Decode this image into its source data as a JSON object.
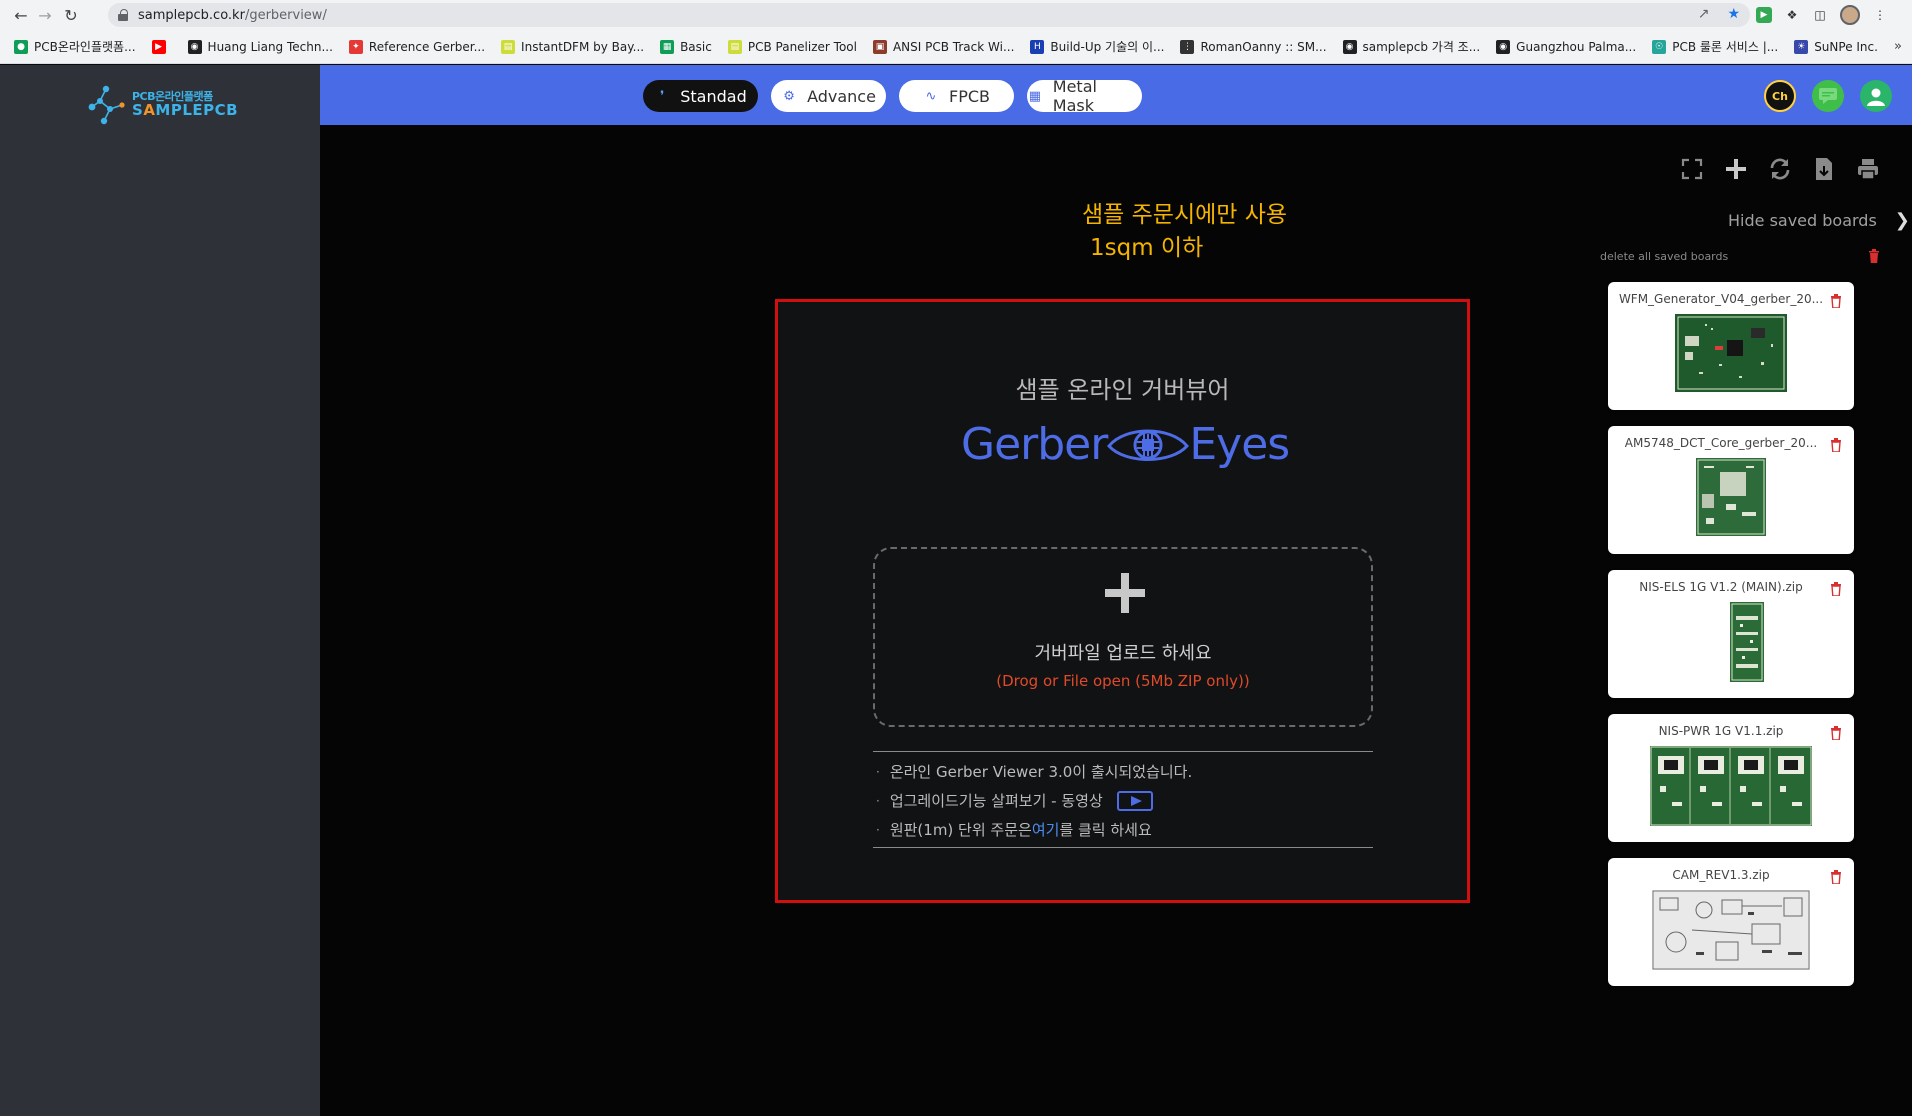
{
  "browser": {
    "url_domain": "samplepcb.co.kr",
    "url_path": "/gerberview/",
    "bookmarks": [
      {
        "label": "PCB온라인플랫폼...",
        "color": "#0f9d58",
        "icon": "green-leaf-icon"
      },
      {
        "label": "",
        "color": "#ff0000",
        "icon": "youtube-icon"
      },
      {
        "label": "Huang Liang Techn...",
        "color": "#202124",
        "icon": "globe-icon"
      },
      {
        "label": "Reference Gerber...",
        "color": "#e53935",
        "icon": "red-square-icon"
      },
      {
        "label": "InstantDFM by Bay...",
        "color": "#cddc39",
        "icon": "dfm-icon"
      },
      {
        "label": "Basic",
        "color": "#0f9d58",
        "icon": "sheets-icon"
      },
      {
        "label": "PCB Panelizer Tool",
        "color": "#cddc39",
        "icon": "panel-icon"
      },
      {
        "label": "ANSI PCB Track Wi...",
        "color": "#8d3b2a",
        "icon": "ansi-icon"
      },
      {
        "label": "Build-Up 기술의 이...",
        "color": "#1a3fb3",
        "icon": "h-icon"
      },
      {
        "label": "RomanOanny :: SM...",
        "color": "#333333",
        "icon": "dots-icon"
      },
      {
        "label": "samplepcb 가격 조...",
        "color": "#202124",
        "icon": "globe-icon"
      },
      {
        "label": "Guangzhou Palma...",
        "color": "#202124",
        "icon": "globe-icon"
      },
      {
        "label": "PCB 룰론 서비스 |...",
        "color": "#26a69a",
        "icon": "bulb-icon"
      },
      {
        "label": "SuNPe Inc.",
        "color": "#3949ab",
        "icon": "sunpe-icon"
      }
    ]
  },
  "sidebar": {
    "logo_top": "PCB온라인플랫폼",
    "logo_bottom_a": "S",
    "logo_bottom_b": "A",
    "logo_bottom_c": "MPLEPCB"
  },
  "topnav": {
    "tabs": [
      {
        "label": "Standad",
        "icon": "standard-icon"
      },
      {
        "label": "Advance",
        "icon": "chip-icon"
      },
      {
        "label": "FPCB",
        "icon": "flex-icon"
      },
      {
        "label": "Metal Mask",
        "icon": "mask-icon"
      }
    ],
    "ch_label": "Ch"
  },
  "main": {
    "notice_line1": "샘플 주문시에만 사용",
    "notice_line2": "1sqm 이하",
    "hide_saved": "Hide saved boards",
    "delete_all": "delete all saved boards",
    "panel": {
      "subtitle": "샘플 온라인 거버뷰어",
      "brand_left": "Gerber",
      "brand_right": "Eyes",
      "drop_title": "거버파일 업로드 하세요",
      "drop_hint": "(Drog or File open (5Mb ZIP only))",
      "info1": "온라인 Gerber Viewer 3.0이 출시되었습니다.",
      "info2": "업그레이드기능 살펴보기 - 동영상",
      "info3_a": "원판(1m) 단위 주문은 ",
      "info3_link": "여기",
      "info3_b": "를 클릭 하세요"
    },
    "boards": [
      {
        "name": "WFM_Generator_V04_gerber_20..."
      },
      {
        "name": "AM5748_DCT_Core_gerber_20..."
      },
      {
        "name": "NIS-ELS 1G V1.2 (MAIN).zip"
      },
      {
        "name": "NIS-PWR 1G V1.1.zip"
      },
      {
        "name": "CAM_REV1.3.zip"
      }
    ]
  },
  "colors": {
    "nav_blue": "#4a6be6",
    "notice_yellow": "#f5b400",
    "panel_border": "#d20f0f",
    "brand_blue": "#4d6ce6",
    "hint_red": "#e04a2a"
  }
}
